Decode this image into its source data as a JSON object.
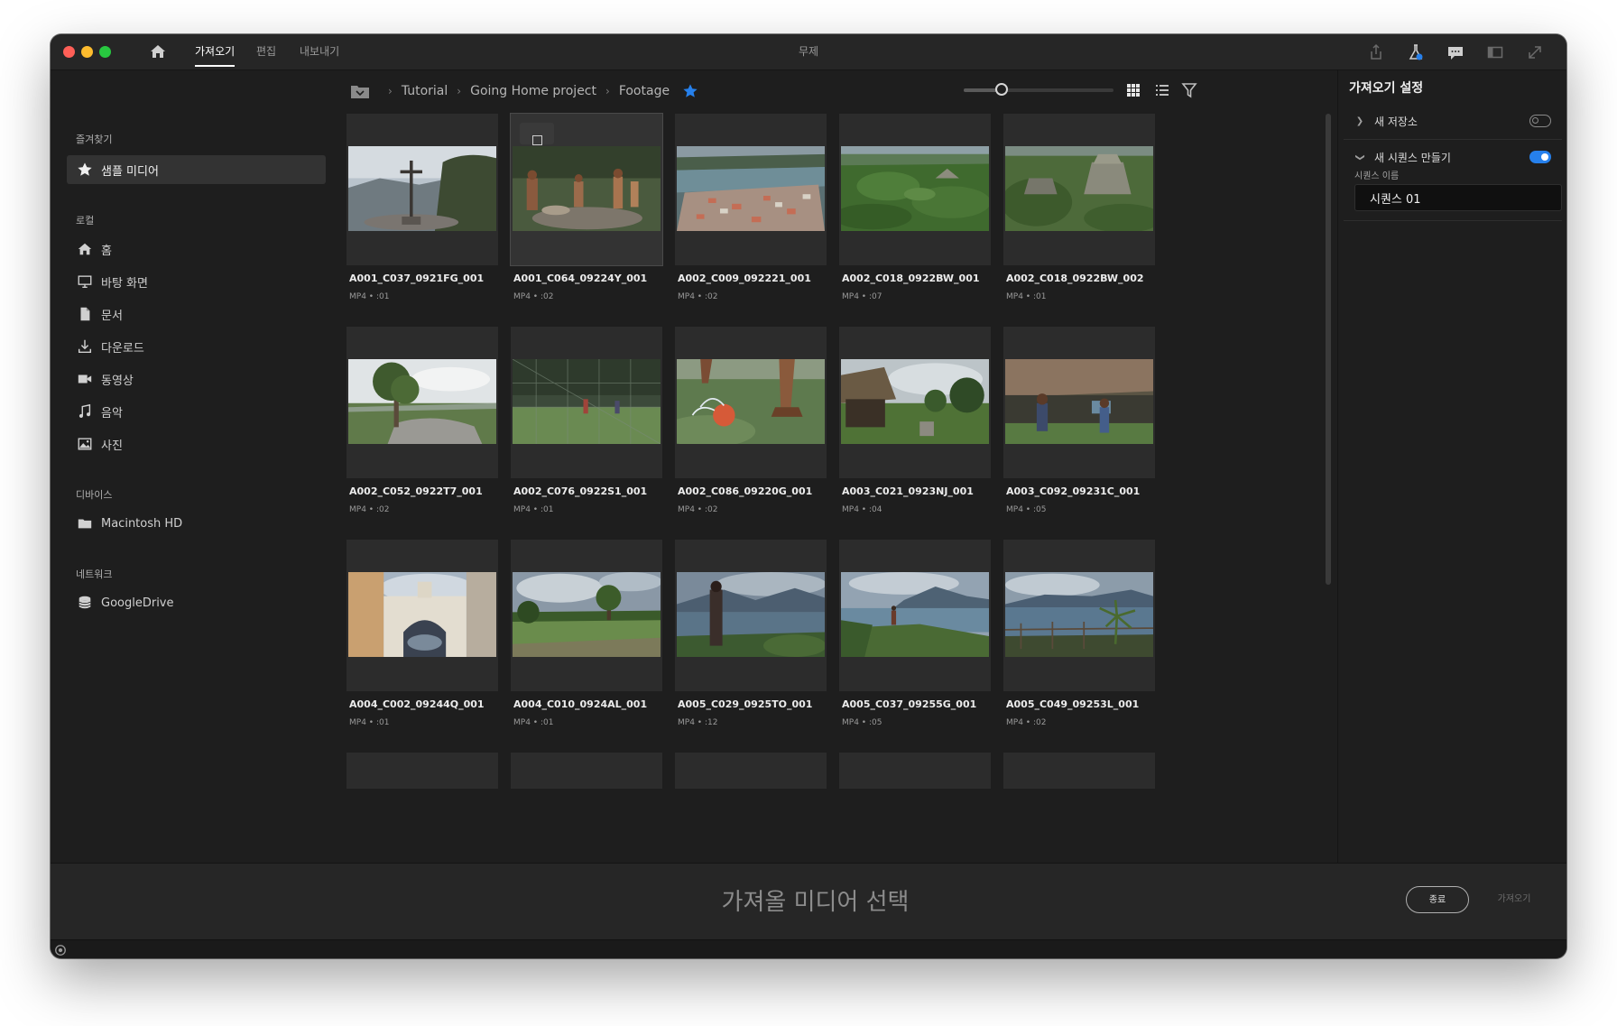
{
  "window": {
    "title": "무제"
  },
  "topbar": {
    "tabs": [
      {
        "label": "가져오기",
        "active": true
      },
      {
        "label": "편집",
        "active": false
      },
      {
        "label": "내보내기",
        "active": false
      }
    ],
    "right_icons": [
      "share-icon",
      "beaker-icon",
      "chat-icon",
      "panel-icon",
      "fullscreen-icon"
    ]
  },
  "sidebar": {
    "favorites": {
      "label": "즐겨찾기",
      "items": [
        {
          "label": "샘플 미디어",
          "icon": "star-icon",
          "selected": true
        }
      ]
    },
    "local": {
      "label": "로컬",
      "items": [
        {
          "label": "홈",
          "icon": "home-icon"
        },
        {
          "label": "바탕 화면",
          "icon": "desktop-icon"
        },
        {
          "label": "문서",
          "icon": "document-icon"
        },
        {
          "label": "다운로드",
          "icon": "download-icon"
        },
        {
          "label": "동영상",
          "icon": "video-icon"
        },
        {
          "label": "음악",
          "icon": "music-icon"
        },
        {
          "label": "사진",
          "icon": "photo-icon"
        }
      ]
    },
    "devices": {
      "label": "디바이스",
      "items": [
        {
          "label": "Macintosh HD",
          "icon": "folder-icon"
        }
      ]
    },
    "network": {
      "label": "네트워크",
      "items": [
        {
          "label": "GoogleDrive",
          "icon": "drive-icon"
        }
      ]
    }
  },
  "browser": {
    "breadcrumb": [
      "Tutorial",
      "Going Home project",
      "Footage"
    ],
    "favorite_star_color": "#2680eb",
    "zoom_level": 0.25
  },
  "clips": [
    {
      "name": "A001_C037_0921FG_001",
      "meta": "MP4 • :01",
      "selected": false
    },
    {
      "name": "A001_C064_09224Y_001",
      "meta": "MP4 • :02",
      "selected": true
    },
    {
      "name": "A002_C009_092221_001",
      "meta": "MP4 • :02",
      "selected": false
    },
    {
      "name": "A002_C018_0922BW_001",
      "meta": "MP4 • :07",
      "selected": false
    },
    {
      "name": "A002_C018_0922BW_002",
      "meta": "MP4 • :01",
      "selected": false
    },
    {
      "name": "A002_C052_0922T7_001",
      "meta": "MP4 • :02",
      "selected": false
    },
    {
      "name": "A002_C076_0922S1_001",
      "meta": "MP4 • :01",
      "selected": false
    },
    {
      "name": "A002_C086_09220G_001",
      "meta": "MP4 • :02",
      "selected": false
    },
    {
      "name": "A003_C021_0923NJ_001",
      "meta": "MP4 • :04",
      "selected": false
    },
    {
      "name": "A003_C092_09231C_001",
      "meta": "MP4 • :05",
      "selected": false
    },
    {
      "name": "A004_C002_09244Q_001",
      "meta": "MP4 • :01",
      "selected": false
    },
    {
      "name": "A004_C010_0924AL_001",
      "meta": "MP4 • :01",
      "selected": false
    },
    {
      "name": "A005_C029_0925TO_001",
      "meta": "MP4 • :12",
      "selected": false
    },
    {
      "name": "A005_C037_09255G_001",
      "meta": "MP4 • :05",
      "selected": false
    },
    {
      "name": "A005_C049_09253L_001",
      "meta": "MP4 • :02",
      "selected": false
    }
  ],
  "import_settings": {
    "title": "가져오기 설정",
    "new_bin": {
      "label": "새 저장소",
      "enabled": false
    },
    "new_sequence": {
      "label": "새 시퀀스 만들기",
      "enabled": true
    },
    "sequence_name_label": "시퀀스 이름",
    "sequence_name_value": "시퀀스 01"
  },
  "footer": {
    "prompt": "가져올 미디어 선택",
    "close_label": "종료",
    "import_label": "가져오기"
  },
  "colors": {
    "accent": "#2680eb",
    "background": "#1e1e1e"
  }
}
